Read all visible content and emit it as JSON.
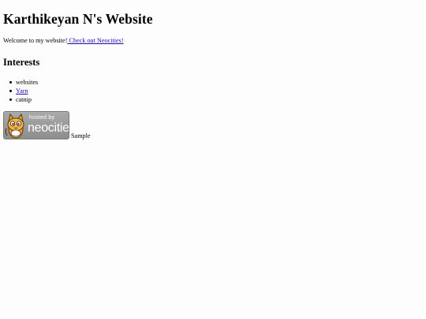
{
  "page": {
    "title": "Karthikeyan N's Website",
    "welcome_text": "Welcome to my website!",
    "welcome_link": " Check out Neocities!",
    "interests_heading": "Interests",
    "interests": [
      {
        "label": "websites",
        "link": false
      },
      {
        "label": "Yarn",
        "link": true
      },
      {
        "label": "catnip",
        "link": false
      }
    ],
    "badge": {
      "hosted_text": "hosted by",
      "brand_text": "neocities",
      "icon": "neocities-cat-icon"
    },
    "sample_text": "Sample"
  },
  "colors": {
    "link": "#1a0dab",
    "background": "#fdfdfd",
    "badge_bg": "#9a9a9a"
  }
}
